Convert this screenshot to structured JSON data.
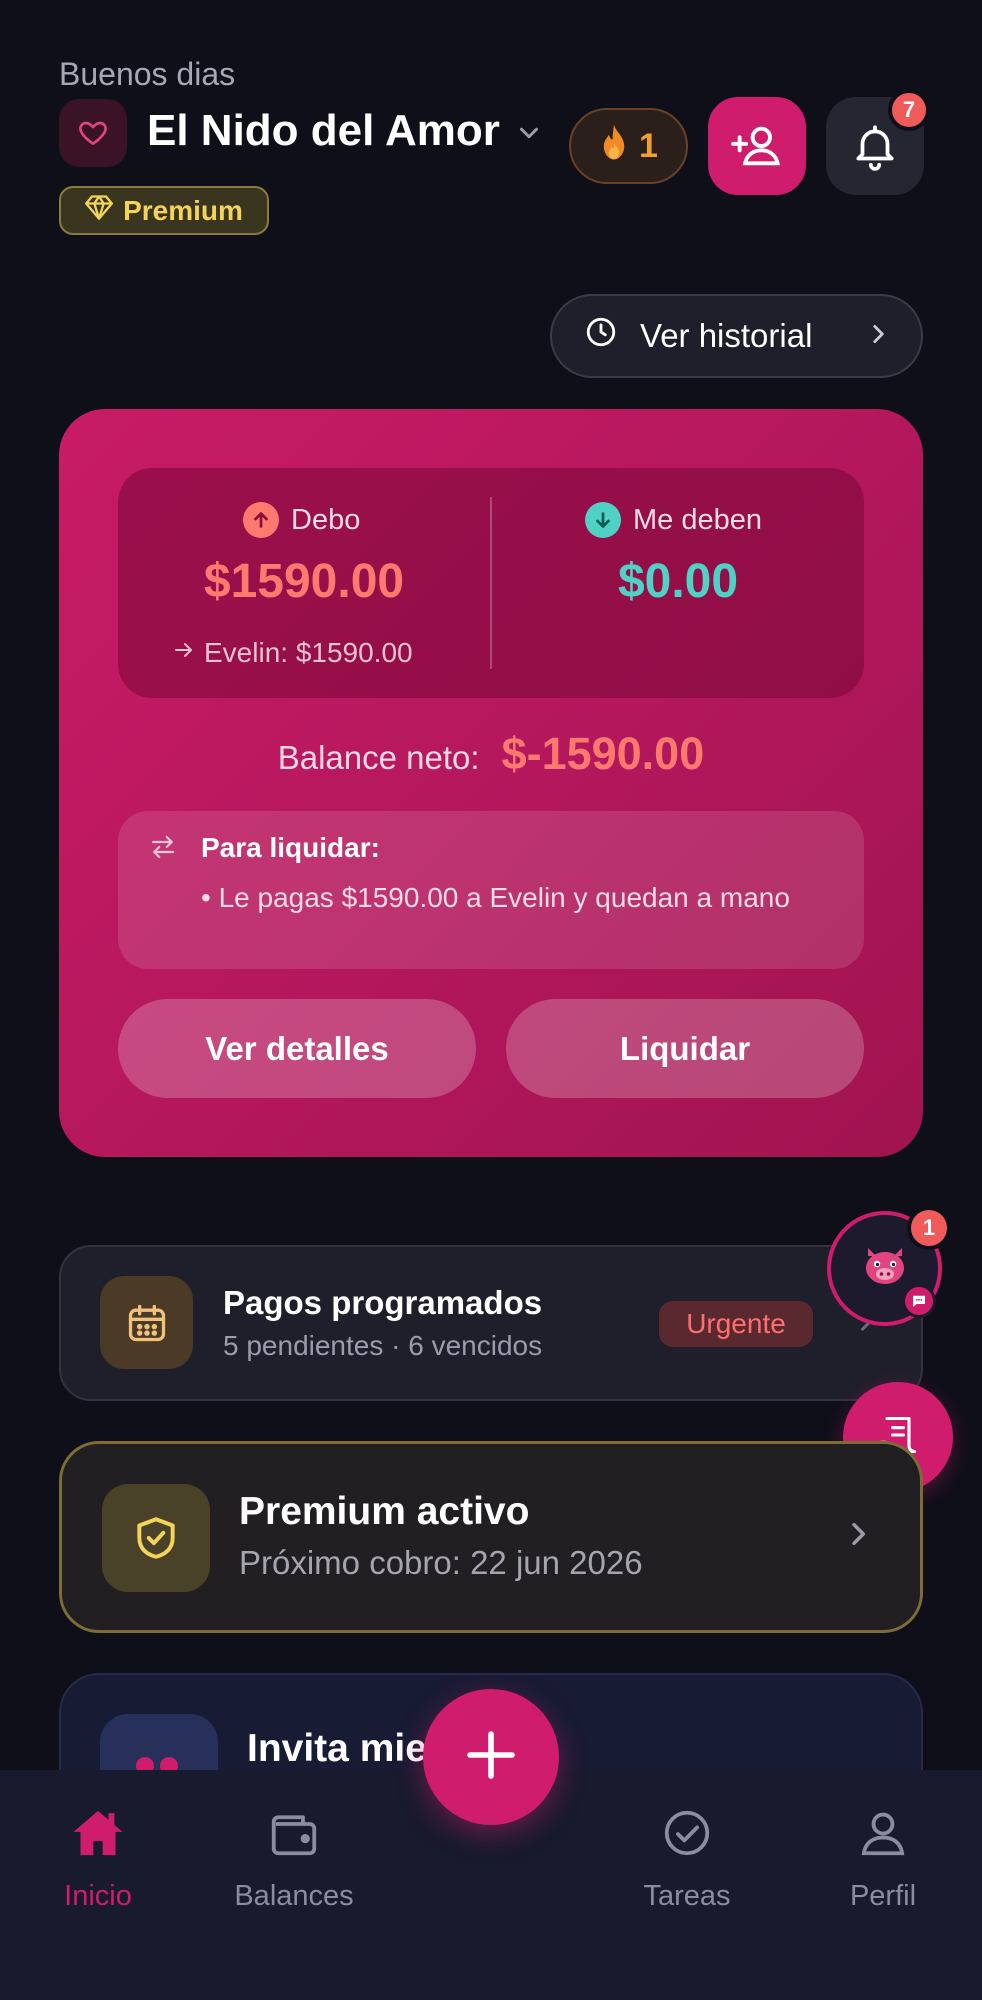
{
  "header": {
    "greeting": "Buenos dias",
    "group_name": "El Nido del Amor",
    "streak_count": "1",
    "notifications_count": "7",
    "plan_badge": "Premium",
    "history_label": "Ver historial"
  },
  "balance": {
    "owe_label": "Debo",
    "owe_amount": "$1590.00",
    "owe_detail": "Evelin: $1590.00",
    "owed_label": "Me deben",
    "owed_amount": "$0.00",
    "net_label": "Balance neto:",
    "net_value": "$-1590.00",
    "settle_title": "Para liquidar:",
    "settle_line": "• Le pagas $1590.00 a Evelin y quedan a mano",
    "details_button": "Ver detalles",
    "settle_button": "Liquidar"
  },
  "scheduled": {
    "title": "Pagos programados",
    "subtitle": "5 pendientes · 6 vencidos",
    "badge": "Urgente"
  },
  "mascot": {
    "badge_count": "1"
  },
  "premium": {
    "title": "Premium activo",
    "subtitle": "Próximo cobro: 22 jun 2026"
  },
  "invite": {
    "title": "Invita mie"
  },
  "nav": {
    "items": [
      {
        "label": "Inicio",
        "icon": "home-icon",
        "active": true
      },
      {
        "label": "Balances",
        "icon": "wallet-icon",
        "active": false
      },
      {
        "label": "Tareas",
        "icon": "check-circle-icon",
        "active": false
      },
      {
        "label": "Perfil",
        "icon": "user-icon",
        "active": false
      }
    ]
  },
  "colors": {
    "accent": "#d01c6c",
    "background": "#0f0f1a",
    "owe": "#ff7a6e",
    "owed": "#4fd1c5",
    "premium_gold": "#f3d35a"
  }
}
